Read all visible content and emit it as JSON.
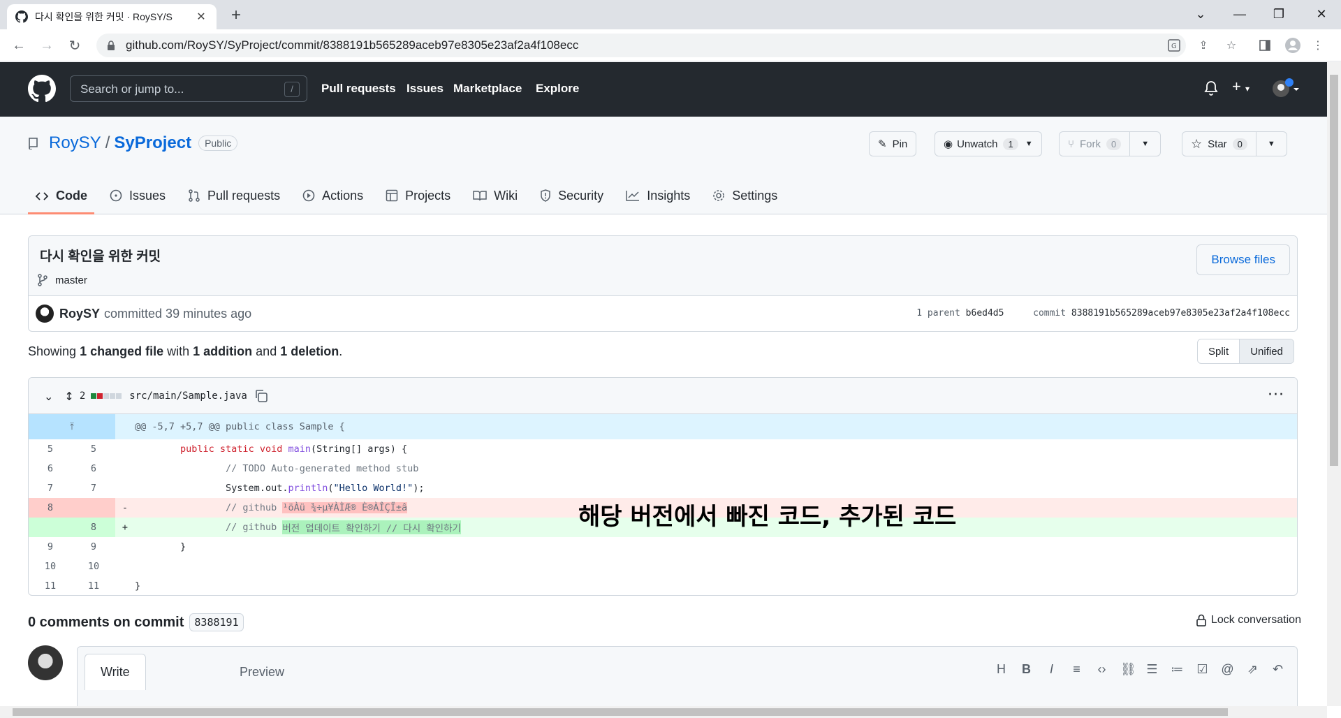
{
  "browser": {
    "tab_title": "다시 확인을 위한 커밋 · RoySY/S",
    "url": "github.com/RoySY/SyProject/commit/8388191b565289aceb97e8305e23af2a4f108ecc"
  },
  "gh": {
    "search_placeholder": "Search or jump to...",
    "slash": "/",
    "nav": [
      "Pull requests",
      "Issues",
      "Marketplace",
      "Explore"
    ]
  },
  "repo": {
    "owner": "RoySY",
    "sep": "/",
    "name": "SyProject",
    "visibility": "Public",
    "pin_label": "Pin",
    "unwatch_label": "Unwatch",
    "unwatch_count": "1",
    "fork_label": "Fork",
    "fork_count": "0",
    "star_label": "Star",
    "star_count": "0",
    "tabs": [
      "Code",
      "Issues",
      "Pull requests",
      "Actions",
      "Projects",
      "Wiki",
      "Security",
      "Insights",
      "Settings"
    ]
  },
  "commit": {
    "title": "다시 확인을 위한 커밋",
    "branch": "master",
    "browse_files": "Browse files",
    "author": "RoySY",
    "committed_text": "committed 39 minutes ago",
    "parent_label": "1 parent",
    "parent_sha": "b6ed4d5",
    "commit_label": "commit",
    "commit_sha": "8388191b565289aceb97e8305e23af2a4f108ecc"
  },
  "summary": {
    "showing": "Showing",
    "files": "1 changed file",
    "with": "with",
    "additions": "1 addition",
    "and": "and",
    "deletions": "1 deletion",
    "end": ".",
    "split": "Split",
    "unified": "Unified"
  },
  "diff": {
    "change_count": "2",
    "file_path": "src/main/Sample.java",
    "hunk_header": "@@ -5,7 +5,7 @@ public class Sample {",
    "rows": [
      {
        "old": "5",
        "new": "5"
      },
      {
        "old": "6",
        "new": "6"
      },
      {
        "old": "7",
        "new": "7"
      },
      {
        "old": "8",
        "new": "",
        "sign": "-"
      },
      {
        "old": "",
        "new": "8",
        "sign": "+"
      },
      {
        "old": "9",
        "new": "9",
        "text": "        }"
      },
      {
        "old": "10",
        "new": "10",
        "text": ""
      },
      {
        "old": "11",
        "new": "11",
        "text": "}"
      }
    ],
    "line5": {
      "indent": "        ",
      "kw1": "public static",
      "sp1": " ",
      "kw2": "void",
      "sp2": " ",
      "fn": "main",
      "rest": "(String[] args) {"
    },
    "line6": {
      "indent": "                ",
      "comment": "// TODO Auto-generated method stub"
    },
    "line7": {
      "indent": "                ",
      "pre": "System.out.",
      "fn": "println",
      "open": "(",
      "str": "\"Hello World!\"",
      "close": ");"
    },
    "line_del": {
      "indent": "                ",
      "comment": "// github ",
      "changed": "¹öÀü ¾÷µ¥ÀÌÆ® È®ÀÎÇÏ±â"
    },
    "line_add": {
      "indent": "                ",
      "comment": "// github ",
      "changed": "버전 업데이트 확인하기 // 다시 확인하기"
    }
  },
  "annotation": "해당 버전에서 빠진 코드, 추가된 코드",
  "comments": {
    "title": "0 comments on commit",
    "sha": "8388191",
    "lock": "Lock conversation",
    "write_tab": "Write",
    "preview_tab": "Preview",
    "tools": [
      "H",
      "B",
      "I"
    ]
  },
  "colors": {
    "header_bg": "#24292f",
    "link": "#0969da",
    "deletion_bg": "#ffebe9",
    "addition_bg": "#e6ffec",
    "hunk_bg": "#ddf4ff",
    "active_tab_underline": "#fd8c73"
  }
}
